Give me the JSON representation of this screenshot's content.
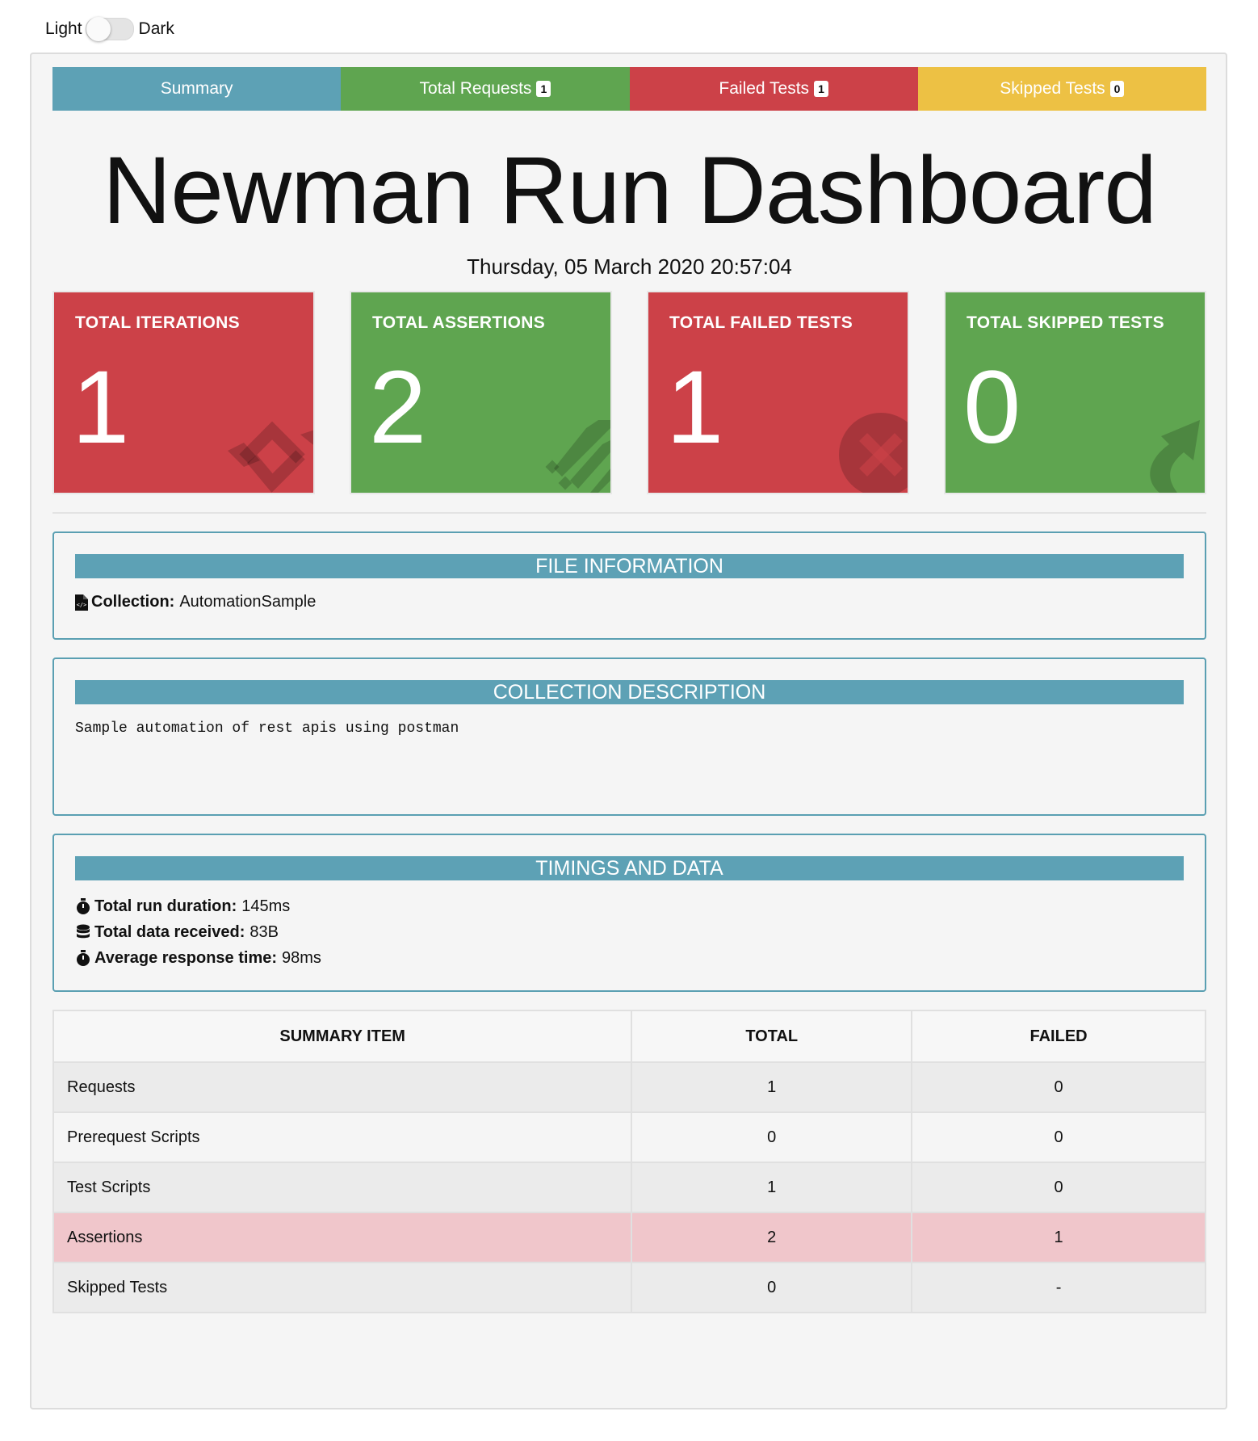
{
  "theme_toggle": {
    "light_label": "Light",
    "dark_label": "Dark"
  },
  "tabs": [
    {
      "label": "Summary",
      "badge": null
    },
    {
      "label": "Total Requests",
      "badge": "1"
    },
    {
      "label": "Failed Tests",
      "badge": "1"
    },
    {
      "label": "Skipped Tests",
      "badge": "0"
    }
  ],
  "header": {
    "title": "Newman Run Dashboard",
    "timestamp": "Thursday, 05 March 2020 20:57:04"
  },
  "cards": [
    {
      "title": "TOTAL ITERATIONS",
      "value": "1",
      "color": "#cc4148",
      "icon": "sync-icon"
    },
    {
      "title": "TOTAL ASSERTIONS",
      "value": "2",
      "color": "#5fa550",
      "icon": "list-icon"
    },
    {
      "title": "TOTAL FAILED TESTS",
      "value": "1",
      "color": "#cc4148",
      "icon": "times-circle-icon"
    },
    {
      "title": "TOTAL SKIPPED TESTS",
      "value": "0",
      "color": "#5fa550",
      "icon": "share-arrow-icon"
    }
  ],
  "file_info": {
    "header": "FILE INFORMATION",
    "collection_label": "Collection:",
    "collection_value": "AutomationSample"
  },
  "collection_description": {
    "header": "COLLECTION DESCRIPTION",
    "text": "Sample automation of rest apis using postman"
  },
  "timings": {
    "header": "TIMINGS AND DATA",
    "items": [
      {
        "label": "Total run duration:",
        "value": "145ms",
        "icon": "stopwatch-icon"
      },
      {
        "label": "Total data received:",
        "value": "83B",
        "icon": "database-icon"
      },
      {
        "label": "Average response time:",
        "value": "98ms",
        "icon": "stopwatch-icon"
      }
    ]
  },
  "summary_table": {
    "headers": [
      "SUMMARY ITEM",
      "TOTAL",
      "FAILED"
    ],
    "rows": [
      {
        "item": "Requests",
        "total": "1",
        "failed": "0"
      },
      {
        "item": "Prerequest Scripts",
        "total": "0",
        "failed": "0"
      },
      {
        "item": "Test Scripts",
        "total": "1",
        "failed": "0"
      },
      {
        "item": "Assertions",
        "total": "2",
        "failed": "1"
      },
      {
        "item": "Skipped Tests",
        "total": "0",
        "failed": "-"
      }
    ]
  }
}
